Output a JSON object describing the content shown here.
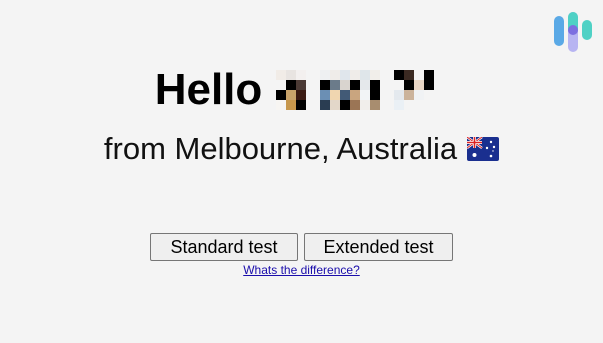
{
  "greeting": {
    "hello": "Hello"
  },
  "location": {
    "text": "from Melbourne, Australia",
    "flag_icon": "australia-flag-icon"
  },
  "actions": {
    "standard_label": "Standard test",
    "extended_label": "Extended test",
    "difference_link": "Whats the difference?"
  },
  "colors": {
    "background": "#f4f4f4",
    "link": "#1a0dab",
    "logo_teal": "#4fd1c5",
    "logo_blue": "#5aa9e6",
    "logo_lavender": "#b7b4f2"
  }
}
